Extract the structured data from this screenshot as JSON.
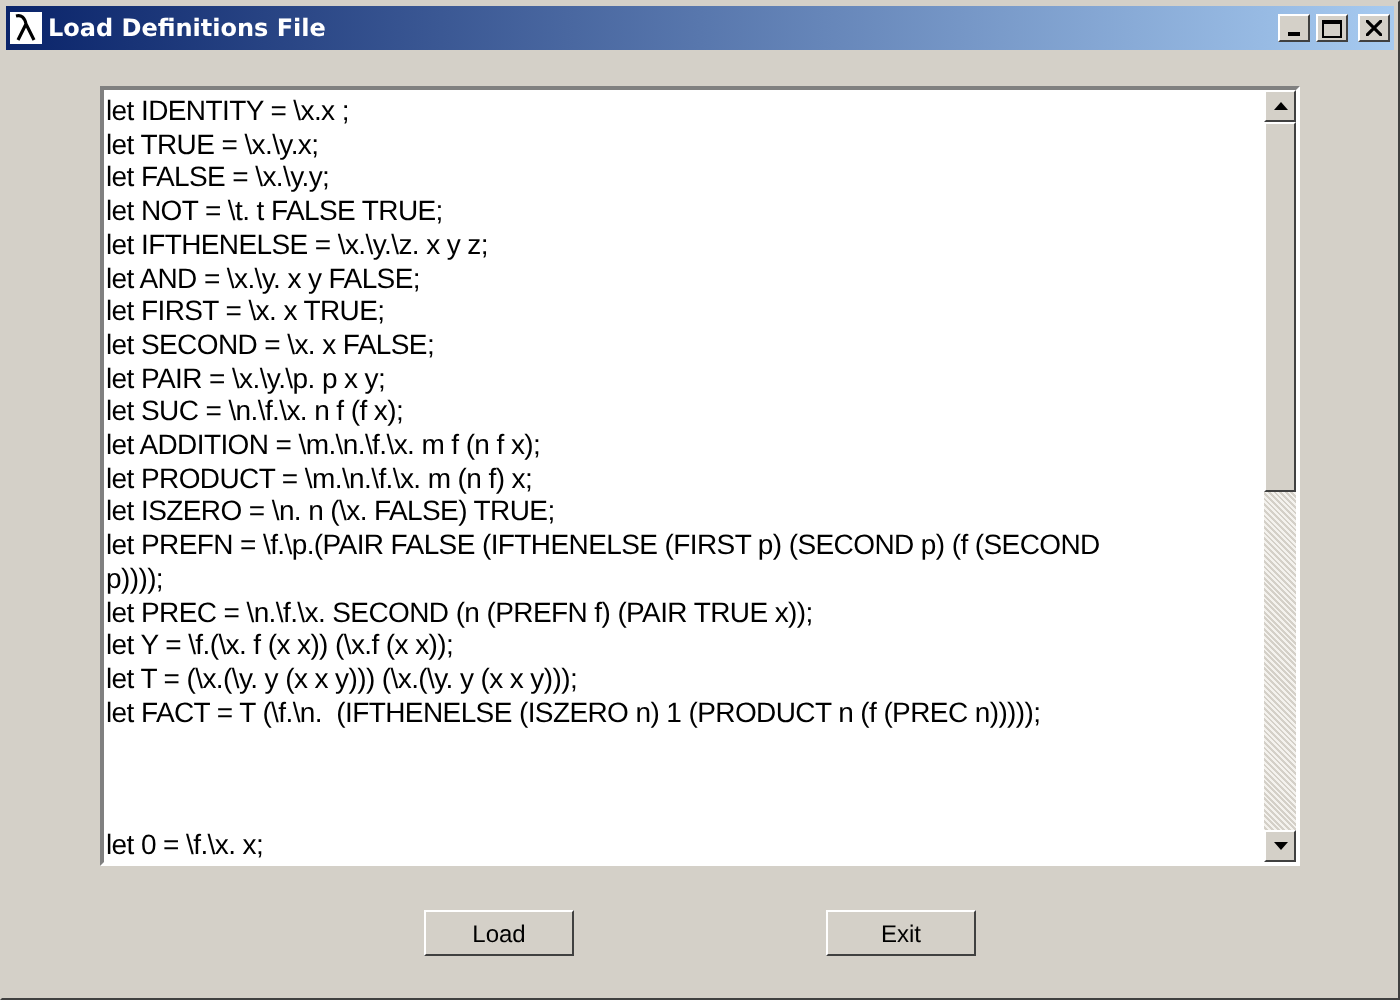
{
  "window": {
    "title": "Load Definitions File"
  },
  "editor": {
    "lines": [
      "let IDENTITY = \\x.x ;",
      "let TRUE = \\x.\\y.x;",
      "let FALSE = \\x.\\y.y;",
      "let NOT = \\t. t FALSE TRUE;",
      "let IFTHENELSE = \\x.\\y.\\z. x y z;",
      "let AND = \\x.\\y. x y FALSE;",
      "let FIRST = \\x. x TRUE;",
      "let SECOND = \\x. x FALSE;",
      "let PAIR = \\x.\\y.\\p. p x y;",
      "let SUC = \\n.\\f.\\x. n f (f x);",
      "let ADDITION = \\m.\\n.\\f.\\x. m f (n f x);",
      "let PRODUCT = \\m.\\n.\\f.\\x. m (n f) x;",
      "let ISZERO = \\n. n (\\x. FALSE) TRUE;",
      "let PREFN = \\f.\\p.(PAIR FALSE (IFTHENELSE (FIRST p) (SECOND p) (f (SECOND",
      "p))));",
      "let PREC = \\n.\\f.\\x. SECOND (n (PREFN f) (PAIR TRUE x));",
      "let Y = \\f.(\\x. f (x x)) (\\x.f (x x));",
      "let T = (\\x.(\\y. y (x x y))) (\\x.(\\y. y (x x y)));",
      "let FACT = T (\\f.\\n.  (IFTHENELSE (ISZERO n) 1 (PRODUCT n (f (PREC n)))));"
    ],
    "lines_after_gap": [
      "let 0 = \\f.\\x. x;"
    ]
  },
  "buttons": [
    "Load",
    "Exit"
  ]
}
